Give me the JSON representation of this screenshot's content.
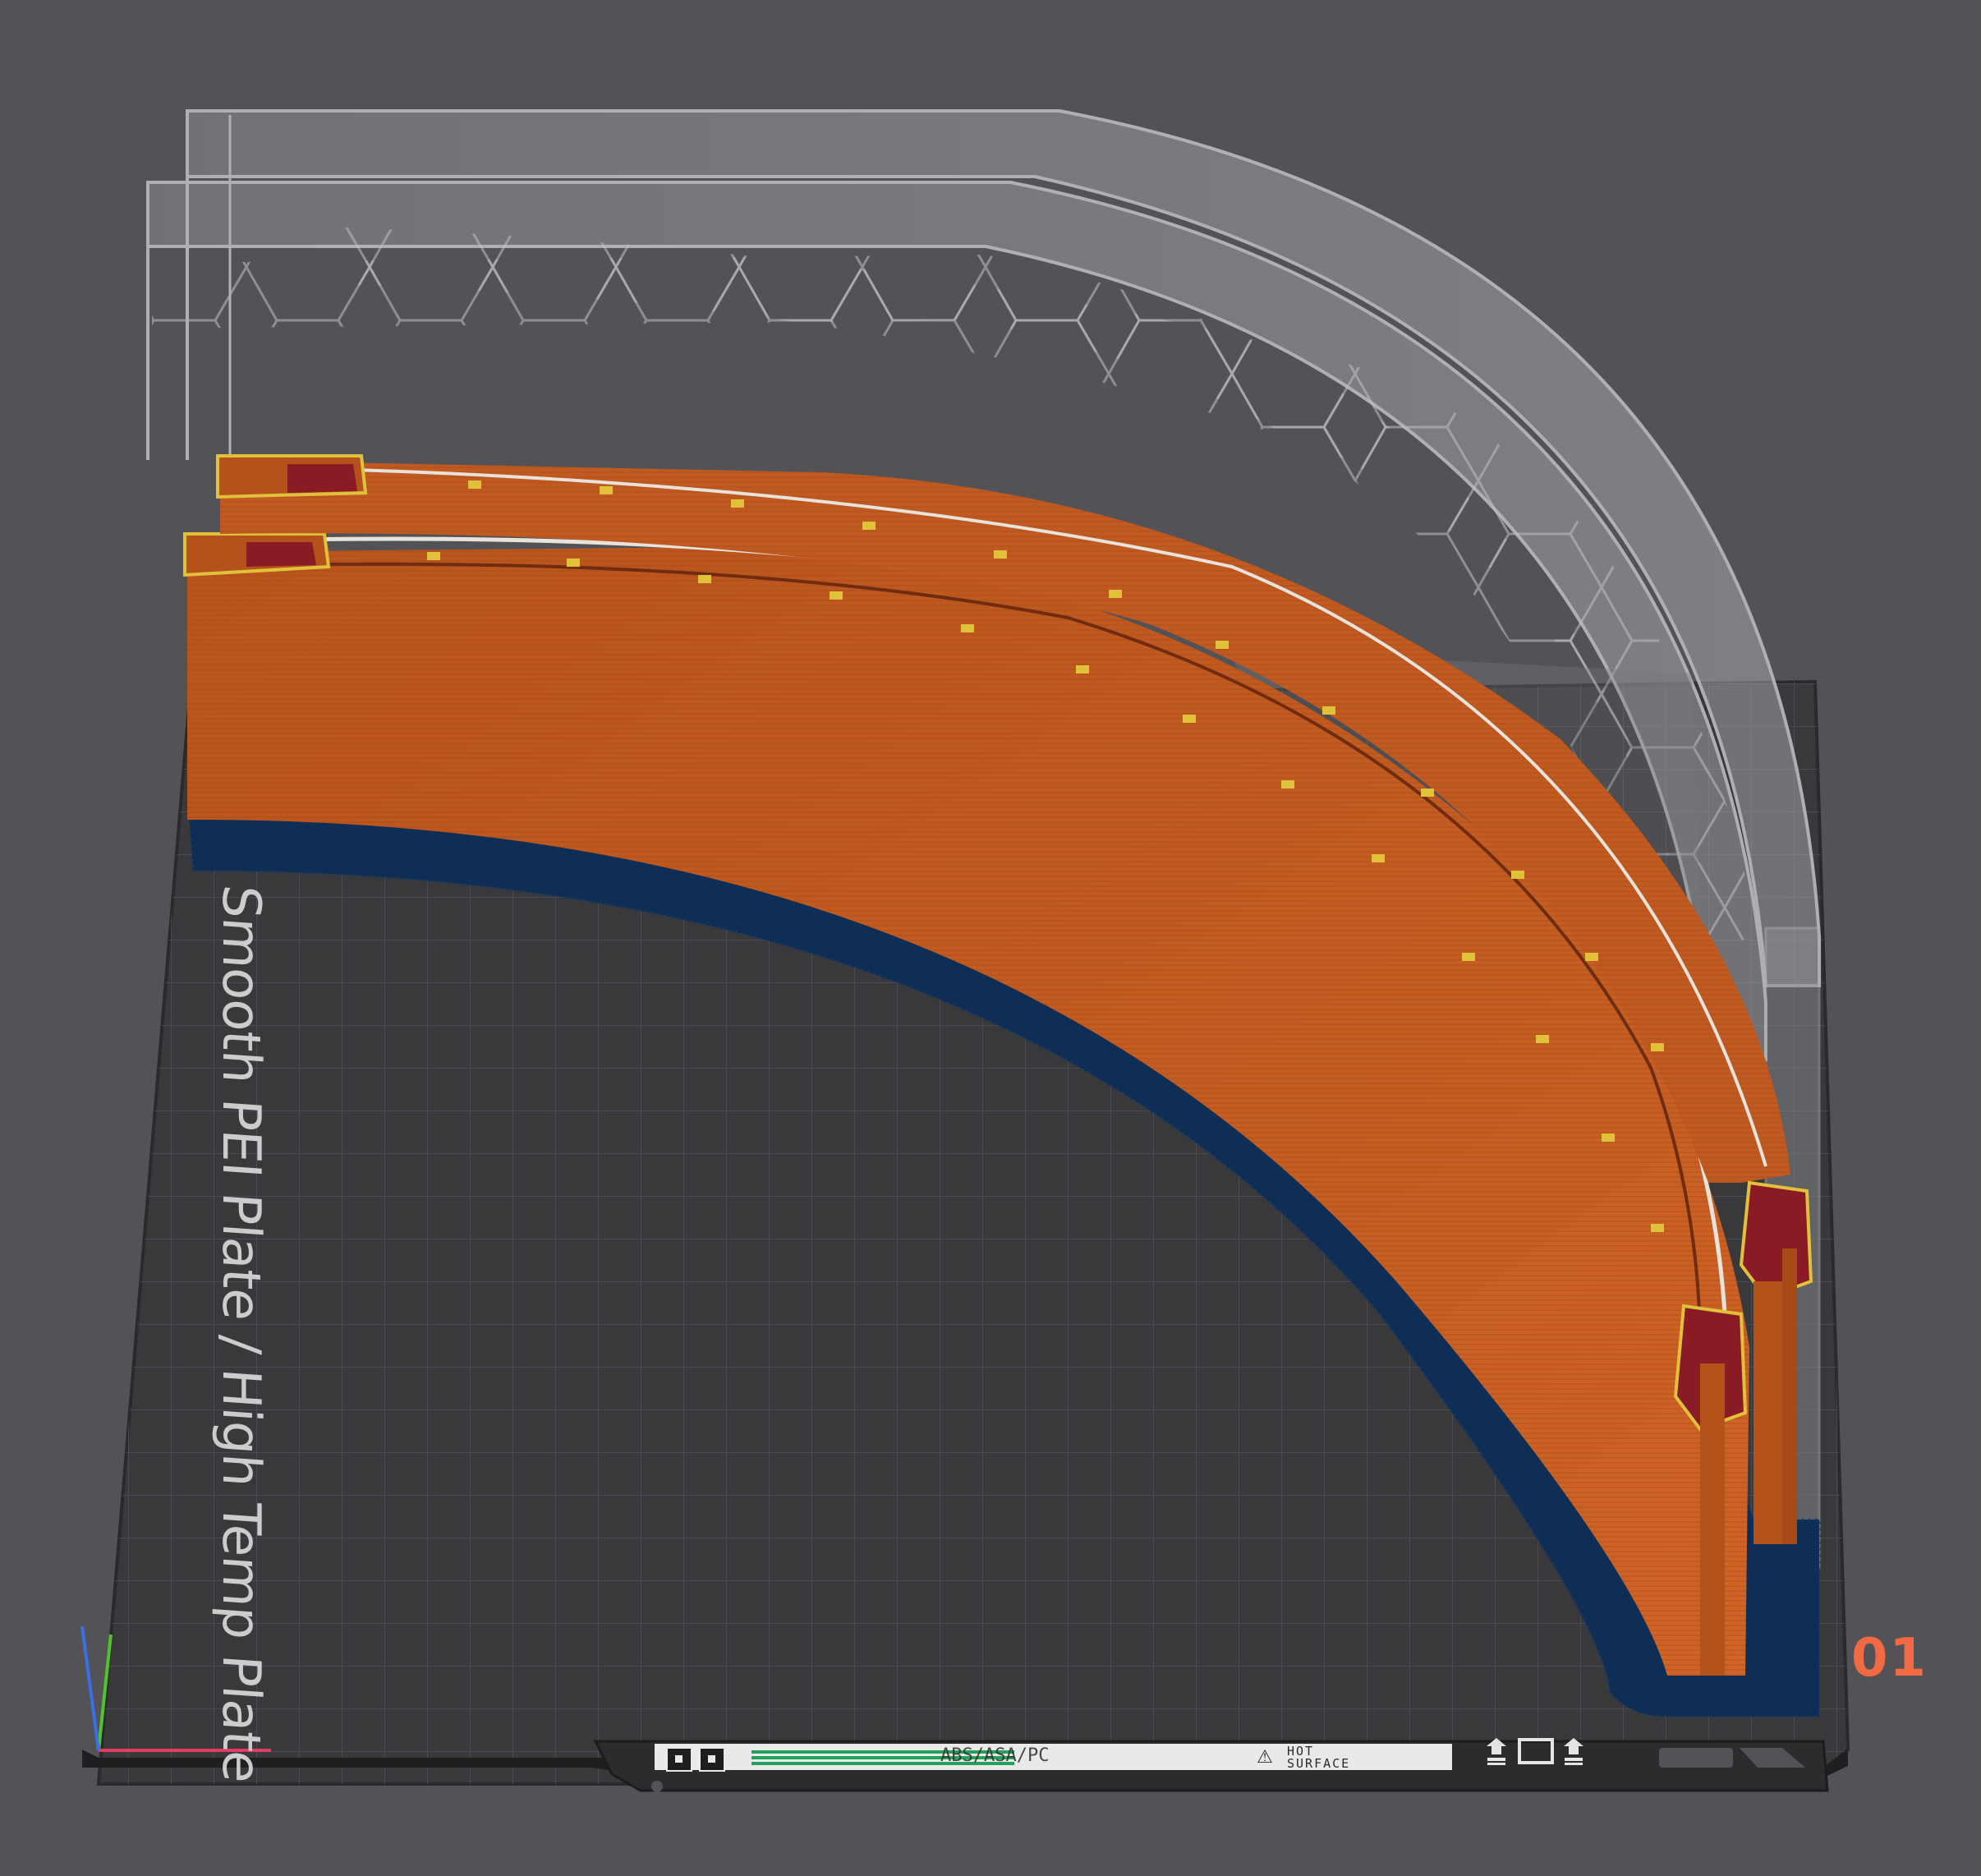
{
  "viewport": {
    "background_color": "#535357",
    "plate": {
      "name": "Smooth PEI Plate / High Temp Plate",
      "number": "01",
      "number_color": "#f26a43",
      "surface_color": "#39393c",
      "grid_line_color": "#505055"
    },
    "label_strip": {
      "material_text": "ABS/ASA/PC",
      "warning_text": "HOT\nSURFACE",
      "warning_icon": "hot-surface-warning-icon"
    },
    "plate_icons": [
      "arrow-up-bar-icon",
      "plate-outline-icon",
      "arrow-up-bar-icon"
    ],
    "colors": {
      "wall": "#c85a1e",
      "wall_dark": "#8f3c16",
      "brim": "#0e2f57",
      "infill": "#8a1a24",
      "ghost_part": "#9fa0a4"
    },
    "axes": [
      "x-axis",
      "y-axis",
      "z-axis"
    ]
  }
}
